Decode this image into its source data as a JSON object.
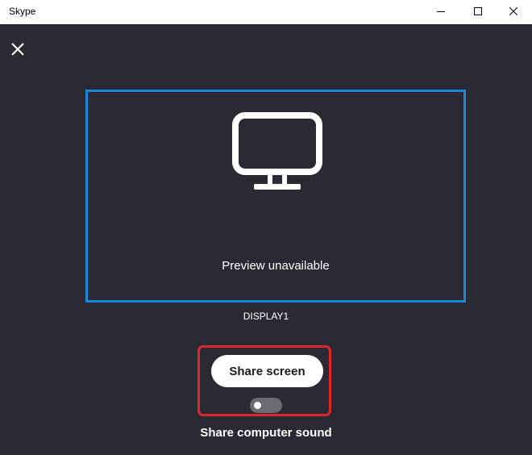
{
  "window": {
    "title": "Skype",
    "controls": [
      "minimize-icon",
      "maximize-icon",
      "close-icon"
    ]
  },
  "panel": {
    "close_icon": "close-icon",
    "preview": {
      "icon": "monitor-icon",
      "text": "Preview unavailable",
      "border_color": "#1b87d9"
    },
    "display_name": "DISPLAY1",
    "share_button_label": "Share screen",
    "sound_toggle": {
      "enabled": false,
      "label": "Share computer sound"
    },
    "highlight_color": "#e0242b"
  },
  "colors": {
    "background": "#292a33",
    "titlebar": "#ffffff",
    "accent": "#1b87d9"
  }
}
